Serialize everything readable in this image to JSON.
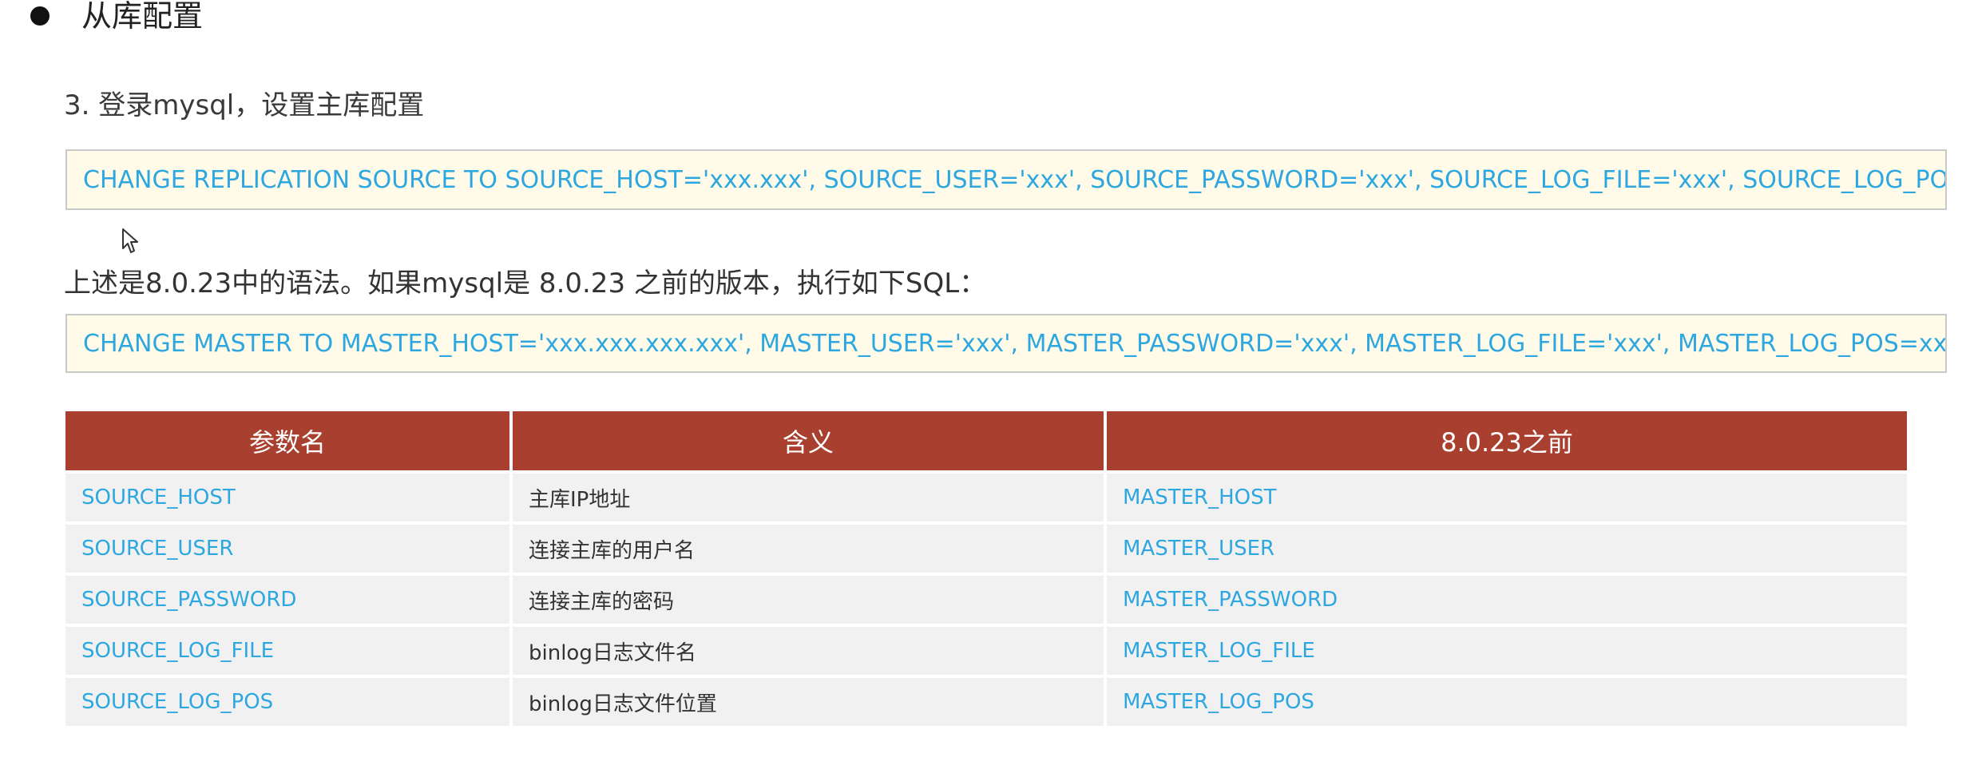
{
  "heading": {
    "title": "从库配置"
  },
  "step": {
    "text": "3. 登录mysql，设置主库配置"
  },
  "code_new": {
    "text": "CHANGE REPLICATION SOURCE TO SOURCE_HOST='xxx.xxx', SOURCE_USER='xxx', SOURCE_PASSWORD='xxx', SOURCE_LOG_FILE='xxx', SOURCE_LOG_POS=xxx;"
  },
  "note": {
    "text": "上述是8.0.23中的语法。如果mysql是 8.0.23 之前的版本，执行如下SQL："
  },
  "code_old": {
    "text": "CHANGE MASTER TO MASTER_HOST='xxx.xxx.xxx.xxx', MASTER_USER='xxx', MASTER_PASSWORD='xxx', MASTER_LOG_FILE='xxx', MASTER_LOG_POS=xxx;"
  },
  "table": {
    "headers": [
      "参数名",
      "含义",
      "8.0.23之前"
    ],
    "rows": [
      [
        "SOURCE_HOST",
        "主库IP地址",
        "MASTER_HOST"
      ],
      [
        "SOURCE_USER",
        "连接主库的用户名",
        "MASTER_USER"
      ],
      [
        "SOURCE_PASSWORD",
        "连接主库的密码",
        "MASTER_PASSWORD"
      ],
      [
        "SOURCE_LOG_FILE",
        "binlog日志文件名",
        "MASTER_LOG_FILE"
      ],
      [
        "SOURCE_LOG_POS",
        "binlog日志文件位置",
        "MASTER_LOG_POS"
      ]
    ]
  },
  "icons": {
    "bullet": "bullet-dot-icon",
    "cursor": "mouse-pointer-icon"
  },
  "colors": {
    "header_bg": "#a93f2f",
    "code_text": "#2ea7e0",
    "code_bg": "#fffbe8",
    "row_bg": "#f1f1f1"
  }
}
